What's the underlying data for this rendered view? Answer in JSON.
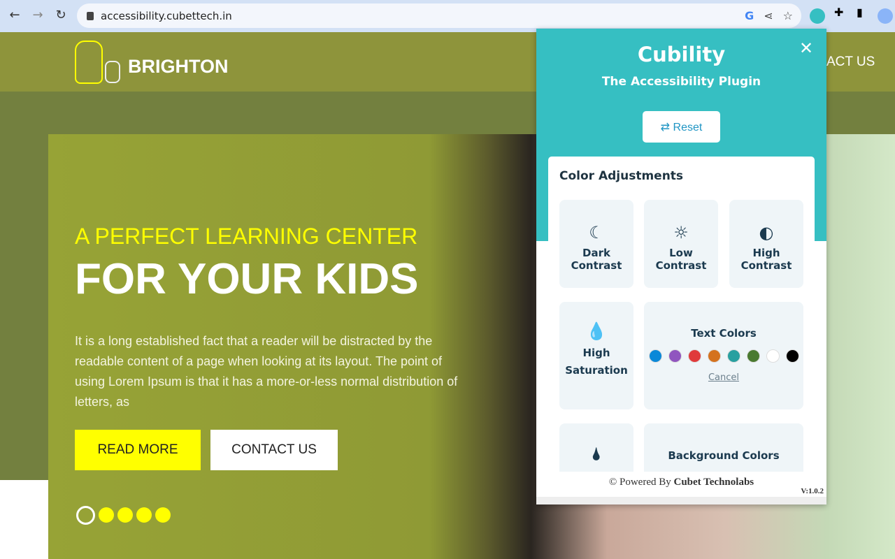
{
  "browser": {
    "url": "accessibility.cubettech.in",
    "back": "←",
    "forward": "→",
    "reload": "↻"
  },
  "site": {
    "brand": "BRIGHTON",
    "nav_partial": "ACT US",
    "subtitle": "A PERFECT LEARNING CENTER",
    "title": "FOR YOUR KIDS",
    "paragraph": "It is a long established fact that a reader will be distracted by the readable content of a page when looking at its layout. The point of using Lorem Ipsum is that it has a more-or-less normal distribution of letters, as",
    "read_more": "READ MORE",
    "contact_us": "CONTACT US",
    "slides": 5,
    "active_slide": 1
  },
  "plugin": {
    "title": "Cubility",
    "subtitle": "The Accessibility Plugin",
    "reset": "Reset",
    "section": "Color Adjustments",
    "tiles": {
      "dark": "Dark Contrast",
      "low": "Low Contrast",
      "high": "High Contrast",
      "saturation": "High Saturation",
      "text_colors": "Text Colors",
      "cancel": "Cancel",
      "bg_colors": "Background Colors"
    },
    "swatches": [
      "#0a88d8",
      "#9055bf",
      "#e03a3a",
      "#d4721e",
      "#28a0a0",
      "#4a7a30",
      "#ffffff",
      "#000000"
    ],
    "footer_prefix": "© Powered By ",
    "footer_brand": "Cubet Technolabs",
    "version": "V:1.0.2"
  },
  "colors": {
    "header": "#8e943b",
    "plugin_accent": "#36bfc2",
    "highlight": "#ffff00"
  }
}
